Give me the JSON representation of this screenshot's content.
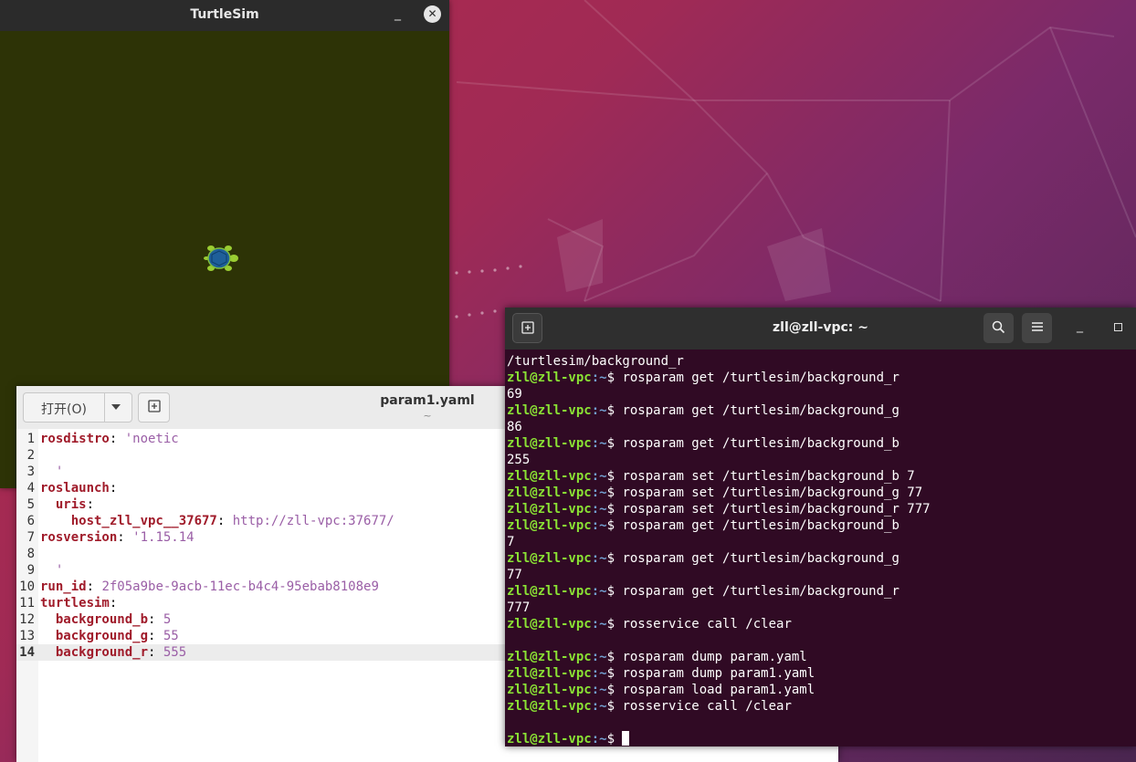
{
  "colors": {
    "turtlesim_bg": "#2d3306",
    "terminal_bg": "#300a24",
    "prompt_user": "#8ae234",
    "prompt_path": "#729fcf",
    "yaml_key": "#a01b2a",
    "yaml_value": "#9a5ea6"
  },
  "turtlesim": {
    "title": "TurtleSim",
    "minimize_glyph": "_",
    "close_glyph": "✕",
    "turtle_icon": "turtle-icon"
  },
  "editor": {
    "open_label": "打开(O)",
    "file_title": "param1.yaml",
    "file_subtitle": "~",
    "lines": [
      {
        "n": "1",
        "key": "rosdistro",
        "sep": ": ",
        "value": "'noetic",
        "indent": ""
      },
      {
        "n": "2",
        "key": "",
        "sep": "",
        "value": "",
        "indent": ""
      },
      {
        "n": "3",
        "key": "",
        "sep": "",
        "value": "'",
        "indent": "  "
      },
      {
        "n": "4",
        "key": "roslaunch",
        "sep": ":",
        "value": "",
        "indent": ""
      },
      {
        "n": "5",
        "key": "uris",
        "sep": ":",
        "value": "",
        "indent": "  "
      },
      {
        "n": "6",
        "key": "host_zll_vpc__37677",
        "sep": ": ",
        "value": "http://zll-vpc:37677/",
        "indent": "    "
      },
      {
        "n": "7",
        "key": "rosversion",
        "sep": ": ",
        "value": "'1.15.14",
        "indent": ""
      },
      {
        "n": "8",
        "key": "",
        "sep": "",
        "value": "",
        "indent": ""
      },
      {
        "n": "9",
        "key": "",
        "sep": "",
        "value": "'",
        "indent": "  "
      },
      {
        "n": "10",
        "key": "run_id",
        "sep": ": ",
        "value": "2f05a9be-9acb-11ec-b4c4-95ebab8108e9",
        "indent": ""
      },
      {
        "n": "11",
        "key": "turtlesim",
        "sep": ":",
        "value": "",
        "indent": ""
      },
      {
        "n": "12",
        "key": "background_b",
        "sep": ": ",
        "value": "5",
        "indent": "  "
      },
      {
        "n": "13",
        "key": "background_g",
        "sep": ": ",
        "value": "55",
        "indent": "  "
      },
      {
        "n": "14",
        "key": "background_r",
        "sep": ": ",
        "value": "555",
        "indent": "  "
      }
    ]
  },
  "terminal": {
    "title": "zll@zll-vpc: ~",
    "prompt_user": "zll@zll-vpc",
    "prompt_path": ":~",
    "prompt_symbol": "$ ",
    "lines": [
      {
        "prompt": false,
        "text": "/turtlesim/background_r"
      },
      {
        "prompt": true,
        "text": "rosparam get /turtlesim/background_r"
      },
      {
        "prompt": false,
        "text": "69"
      },
      {
        "prompt": true,
        "text": "rosparam get /turtlesim/background_g"
      },
      {
        "prompt": false,
        "text": "86"
      },
      {
        "prompt": true,
        "text": "rosparam get /turtlesim/background_b"
      },
      {
        "prompt": false,
        "text": "255"
      },
      {
        "prompt": true,
        "text": "rosparam set /turtlesim/background_b 7"
      },
      {
        "prompt": true,
        "text": "rosparam set /turtlesim/background_g 77"
      },
      {
        "prompt": true,
        "text": "rosparam set /turtlesim/background_r 777"
      },
      {
        "prompt": true,
        "text": "rosparam get /turtlesim/background_b"
      },
      {
        "prompt": false,
        "text": "7"
      },
      {
        "prompt": true,
        "text": "rosparam get /turtlesim/background_g"
      },
      {
        "prompt": false,
        "text": "77"
      },
      {
        "prompt": true,
        "text": "rosparam get /turtlesim/background_r"
      },
      {
        "prompt": false,
        "text": "777"
      },
      {
        "prompt": true,
        "text": "rosservice call /clear"
      },
      {
        "prompt": false,
        "text": ""
      },
      {
        "prompt": true,
        "text": "rosparam dump param.yaml"
      },
      {
        "prompt": true,
        "text": "rosparam dump param1.yaml"
      },
      {
        "prompt": true,
        "text": "rosparam load param1.yaml"
      },
      {
        "prompt": true,
        "text": "rosservice call /clear"
      },
      {
        "prompt": false,
        "text": ""
      },
      {
        "prompt": true,
        "text": "",
        "cursor": true
      }
    ]
  }
}
